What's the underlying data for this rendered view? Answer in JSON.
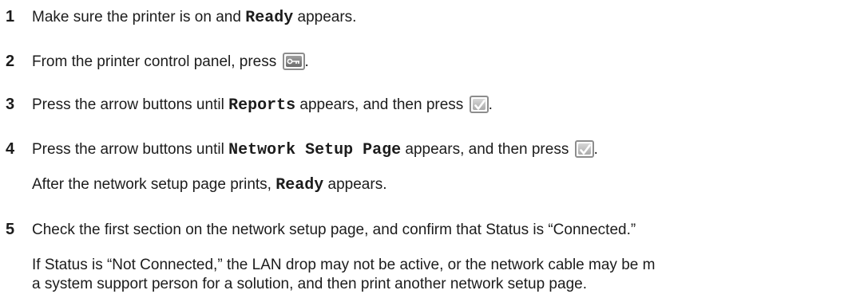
{
  "steps": [
    {
      "number": "1",
      "parts": [
        "Make sure the printer is on and ",
        "Ready",
        " appears."
      ]
    },
    {
      "number": "2",
      "parts": [
        "From the printer control panel, press ",
        "."
      ],
      "icon": "menu-key-icon"
    },
    {
      "number": "3",
      "parts": [
        "Press the arrow buttons until ",
        "Reports",
        " appears, and then press ",
        "."
      ],
      "icon": "select-check-icon"
    },
    {
      "number": "4",
      "parts": [
        "Press the arrow buttons until ",
        "Network Setup Page",
        " appears, and then press ",
        "."
      ],
      "icon": "select-check-icon",
      "note": [
        "After the network setup page prints, ",
        "Ready",
        " appears."
      ]
    },
    {
      "number": "5",
      "parts": [
        "Check the first section on the network setup page, and confirm that Status is “Connected.”"
      ],
      "note_lines": [
        "If Status is “Not Connected,” the LAN drop may not be active, or the network cable may be m",
        "a system support person for a solution, and then print another network setup page."
      ]
    }
  ]
}
